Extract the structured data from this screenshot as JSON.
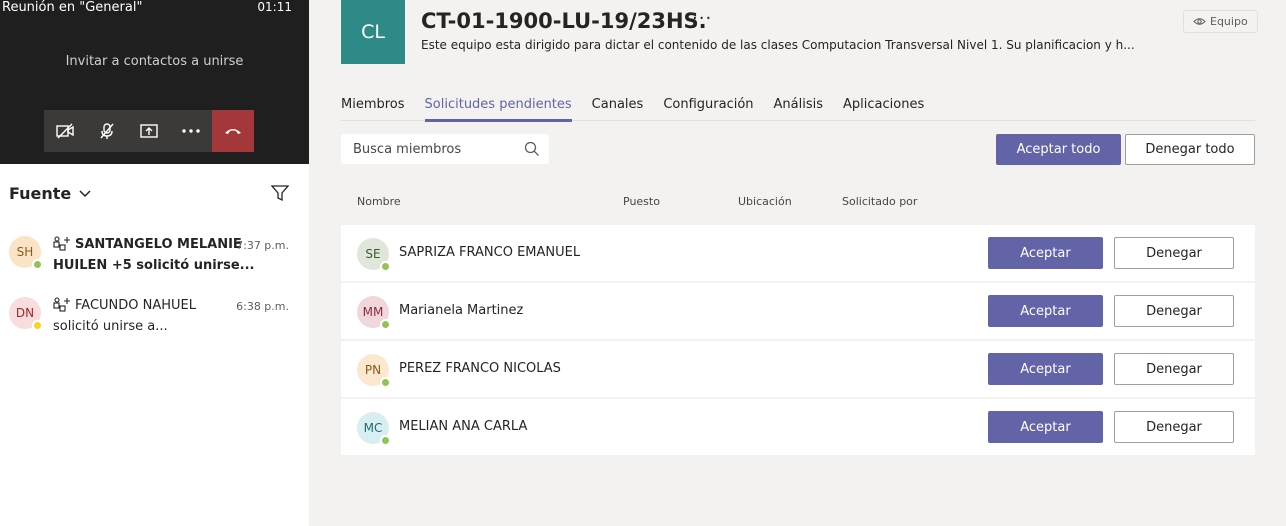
{
  "meeting": {
    "title": "Reunión en \"General\"",
    "time": "01:11",
    "invite_text": "Invitar a contactos a unirse",
    "controls": [
      "camera-off-icon",
      "mic-off-icon",
      "share-screen-icon",
      "more-icon",
      "hang-up-icon"
    ]
  },
  "feed": {
    "title": "Fuente",
    "items": [
      {
        "initials": "SH",
        "line1": "SANTANGELO MELANIE",
        "line2": "HUILEN +5 solicitó unirse...",
        "time": "7:37 p.m.",
        "avatar_bg": "#fbe4c6",
        "avatar_color": "#8a5a1e",
        "presence_color": "#92c353"
      },
      {
        "initials": "DN",
        "line1": "FACUNDO NAHUEL",
        "line2": "solicitó unirse a...",
        "time": "6:38 p.m.",
        "avatar_bg": "#f9dcdc",
        "avatar_color": "#9c2a2a",
        "presence_color": "#f8d22a"
      }
    ]
  },
  "team": {
    "initials": "CL",
    "name": "CT-01-1900-LU-19/23HS.",
    "more": "···",
    "description": "Este equipo esta dirigido para dictar el contenido de las clases Computacion Transversal Nivel 1. Su planificacion y h...",
    "badge": "Equipo",
    "accent": "#6264a7",
    "avatar_bg": "#2d8a86"
  },
  "tabs": [
    "Miembros",
    "Solicitudes pendientes",
    "Canales",
    "Configuración",
    "Análisis",
    "Aplicaciones"
  ],
  "active_tab": "Solicitudes pendientes",
  "search": {
    "placeholder": "Busca miembros"
  },
  "actions": {
    "accept_all": "Aceptar todo",
    "deny_all": "Denegar todo"
  },
  "columns": [
    "Nombre",
    "Puesto",
    "Ubicación",
    "Solicitado por"
  ],
  "requests": [
    {
      "initials": "SE",
      "name": "SAPRIZA FRANCO EMANUEL",
      "avatar_bg": "#e1e6dc",
      "avatar_color": "#3d5a2a",
      "accept": "Aceptar",
      "deny": "Denegar"
    },
    {
      "initials": "MM",
      "name": "Marianela Martinez",
      "avatar_bg": "#f1d6dc",
      "avatar_color": "#8a2c44",
      "accept": "Aceptar",
      "deny": "Denegar"
    },
    {
      "initials": "PN",
      "name": "PEREZ FRANCO NICOLAS",
      "avatar_bg": "#fce8cf",
      "avatar_color": "#8a5a1e",
      "accept": "Aceptar",
      "deny": "Denegar"
    },
    {
      "initials": "MC",
      "name": "MELIAN ANA CARLA",
      "avatar_bg": "#d8eef0",
      "avatar_color": "#1f6b70",
      "accept": "Aceptar",
      "deny": "Denegar"
    }
  ]
}
